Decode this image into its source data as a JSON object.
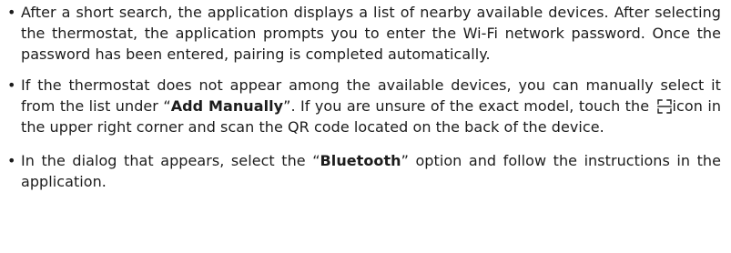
{
  "bullets": [
    {
      "text": "After a short search, the application displays a list of nearby available devices. After selecting the thermostat, the application prompts you to enter the Wi-Fi network password. Once the password has been entered, pairing is completed automatically."
    },
    {
      "part1": "If the thermostat does not appear among the available devices, you can manually select it from the list under “",
      "bold": "Add Manually",
      "part2": "”. If you are unsure of the exact model, touch the",
      "icon": "qr-scan-icon",
      "part3": "icon in the upper right corner and scan the QR code located on the back of the device."
    },
    {
      "part1": "In the dialog that appears, select the “",
      "bold": "Bluetooth",
      "part2": "” option and follow the instructions in the application."
    }
  ],
  "bullet_symbol": "•"
}
